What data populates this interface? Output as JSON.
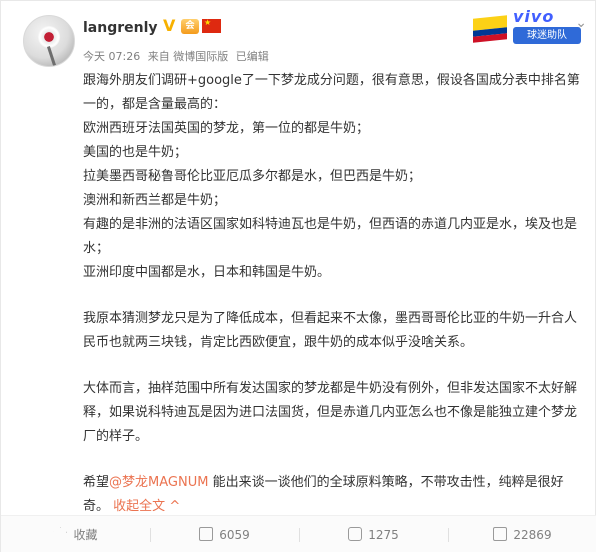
{
  "user": {
    "name": "langrenly",
    "level_badge": "会",
    "flag_star": "★"
  },
  "meta": {
    "time": "今天 07:26",
    "source": "来自 微博国际版",
    "edited": "已编辑"
  },
  "ad": {
    "brand": "vivo",
    "banner": "球迷助队"
  },
  "post": {
    "para1": [
      "跟海外朋友们调研+google了一下梦龙成分问题，很有意思，假设各国成分表中排名第一的，都是含量最高的：",
      "欧洲西班牙法国英国的梦龙，第一位的都是牛奶；",
      "美国的也是牛奶；",
      "拉美墨西哥秘鲁哥伦比亚厄瓜多尔都是水，但巴西是牛奶；",
      "澳洲和新西兰都是牛奶；",
      "有趣的是非洲的法语区国家如科特迪瓦也是牛奶，但西语的赤道几内亚是水，埃及也是水；",
      "亚洲印度中国都是水，日本和韩国是牛奶。"
    ],
    "para2": "我原本猜测梦龙只是为了降低成本，但看起来不太像，墨西哥哥伦比亚的牛奶一升合人民币也就两三块钱，肯定比西欧便宜，跟牛奶的成本似乎没啥关系。",
    "para3": "大体而言，抽样范围中所有发达国家的梦龙都是牛奶没有例外，但非发达国家不太好解释，如果说科特迪瓦是因为进口法国货，但是赤道几内亚怎么也不像是能独立建个梦龙厂的样子。",
    "para4_prefix": "希望",
    "mention": "@梦龙MAGNUM",
    "para4_suffix": " 能出来谈一谈他们的全球原料策略，不带攻击性，纯粹是很好奇。",
    "collapse": "收起全文",
    "collapse_arrow": "^"
  },
  "footer": {
    "favorite": "收藏",
    "share": "6059",
    "comment": "1275",
    "like": "22869"
  },
  "colors": {
    "accent": "#eb7350",
    "text": "#333333",
    "muted": "#808080"
  }
}
